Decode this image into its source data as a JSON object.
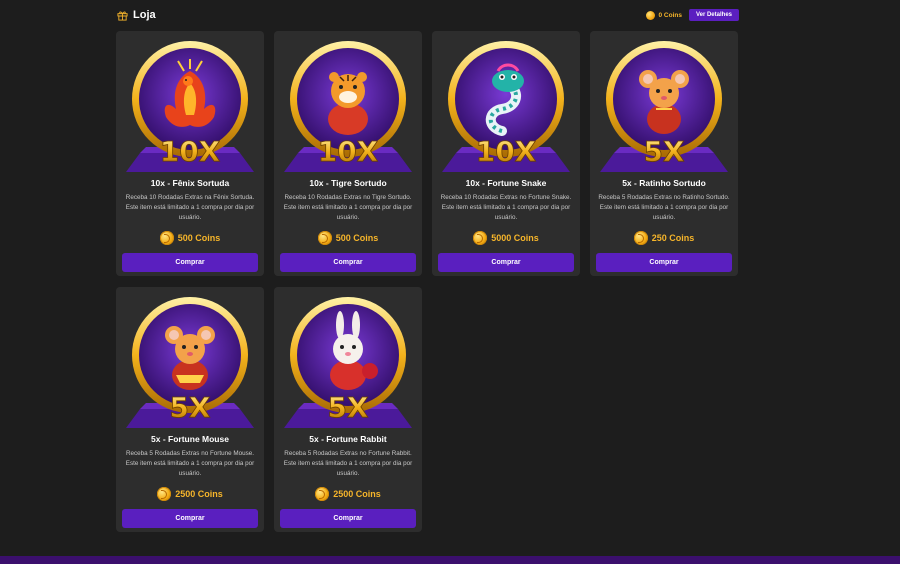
{
  "header": {
    "title": "Loja",
    "coins_label": "0 Coins",
    "details_label": "Ver Detalhes",
    "icons": {
      "title": "gift-icon",
      "coins": "coin-icon"
    }
  },
  "colors": {
    "background": "#1d1d1d",
    "card": "#2d2d2d",
    "accent": "#5a1fbf",
    "gold": "#f6b52a",
    "footer": "#3b0f6d"
  },
  "products": [
    {
      "name": "10x - Fênix Sortuda",
      "multiplier": "10X",
      "description": "Receba 10 Rodadas Extras na Fênix Sortuda. Este item está limitado a 1 compra por dia por usuário.",
      "price": "500 Coins",
      "button": "Comprar",
      "mascot": "phoenix"
    },
    {
      "name": "10x - Tigre Sortudo",
      "multiplier": "10X",
      "description": "Receba 10 Rodadas Extras no Tigre Sortudo. Este item está limitado a 1 compra por dia por usuário.",
      "price": "500 Coins",
      "button": "Comprar",
      "mascot": "tiger"
    },
    {
      "name": "10x - Fortune Snake",
      "multiplier": "10X",
      "description": "Receba 10 Rodadas Extras no Fortune Snake. Este item está limitado a 1 compra por dia por usuário.",
      "price": "5000 Coins",
      "button": "Comprar",
      "mascot": "snake"
    },
    {
      "name": "5x - Ratinho Sortudo",
      "multiplier": "5X",
      "description": "Receba 5 Rodadas Extras no Ratinho Sortudo. Este item está limitado a 1 compra por dia por usuário.",
      "price": "250 Coins",
      "button": "Comprar",
      "mascot": "mouse"
    },
    {
      "name": "5x - Fortune Mouse",
      "multiplier": "5X",
      "description": "Receba 5 Rodadas Extras no Fortune Mouse. Este item está limitado a 1 compra por dia por usuário.",
      "price": "2500 Coins",
      "button": "Comprar",
      "mascot": "mouse-gold"
    },
    {
      "name": "5x - Fortune Rabbit",
      "multiplier": "5X",
      "description": "Receba 5 Rodadas Extras no Fortune Rabbit. Este item está limitado a 1 compra por dia por usuário.",
      "price": "2500 Coins",
      "button": "Comprar",
      "mascot": "rabbit"
    }
  ]
}
